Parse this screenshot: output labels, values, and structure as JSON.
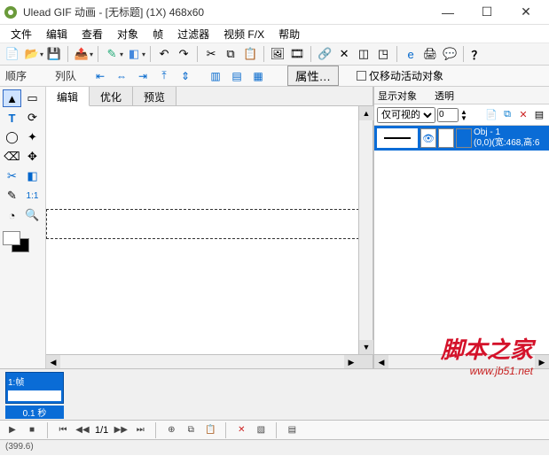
{
  "title": "Ulead GIF 动画 - [无标题] (1X) 468x60",
  "winbtns": {
    "minimize": "—",
    "maximize": "☐",
    "close": "✕"
  },
  "menu": [
    "文件",
    "编辑",
    "查看",
    "对象",
    "帧",
    "过滤器",
    "视频 F/X",
    "帮助"
  ],
  "secondbar": {
    "order_label": "顺序",
    "queue_label": "列队",
    "prop_button": "属性…",
    "lock_checkbox": "仅移动活动对象"
  },
  "center_tabs": {
    "edit": "编辑",
    "optimize": "优化",
    "preview": "预览"
  },
  "rightpane": {
    "header_left": "显示对象",
    "header_right": "透明",
    "visibility_select": "仅可视的",
    "opacity_value": "0"
  },
  "object_row": {
    "name": "Obj - 1",
    "info": "(0,0)(宽:468,高:6"
  },
  "frame": {
    "label": "1:帧",
    "duration": "0.1 秒"
  },
  "playbar": {
    "position": "1/1"
  },
  "status": "(399.6)",
  "watermark": {
    "main": "脚本之家",
    "url": "www.jb51.net"
  }
}
